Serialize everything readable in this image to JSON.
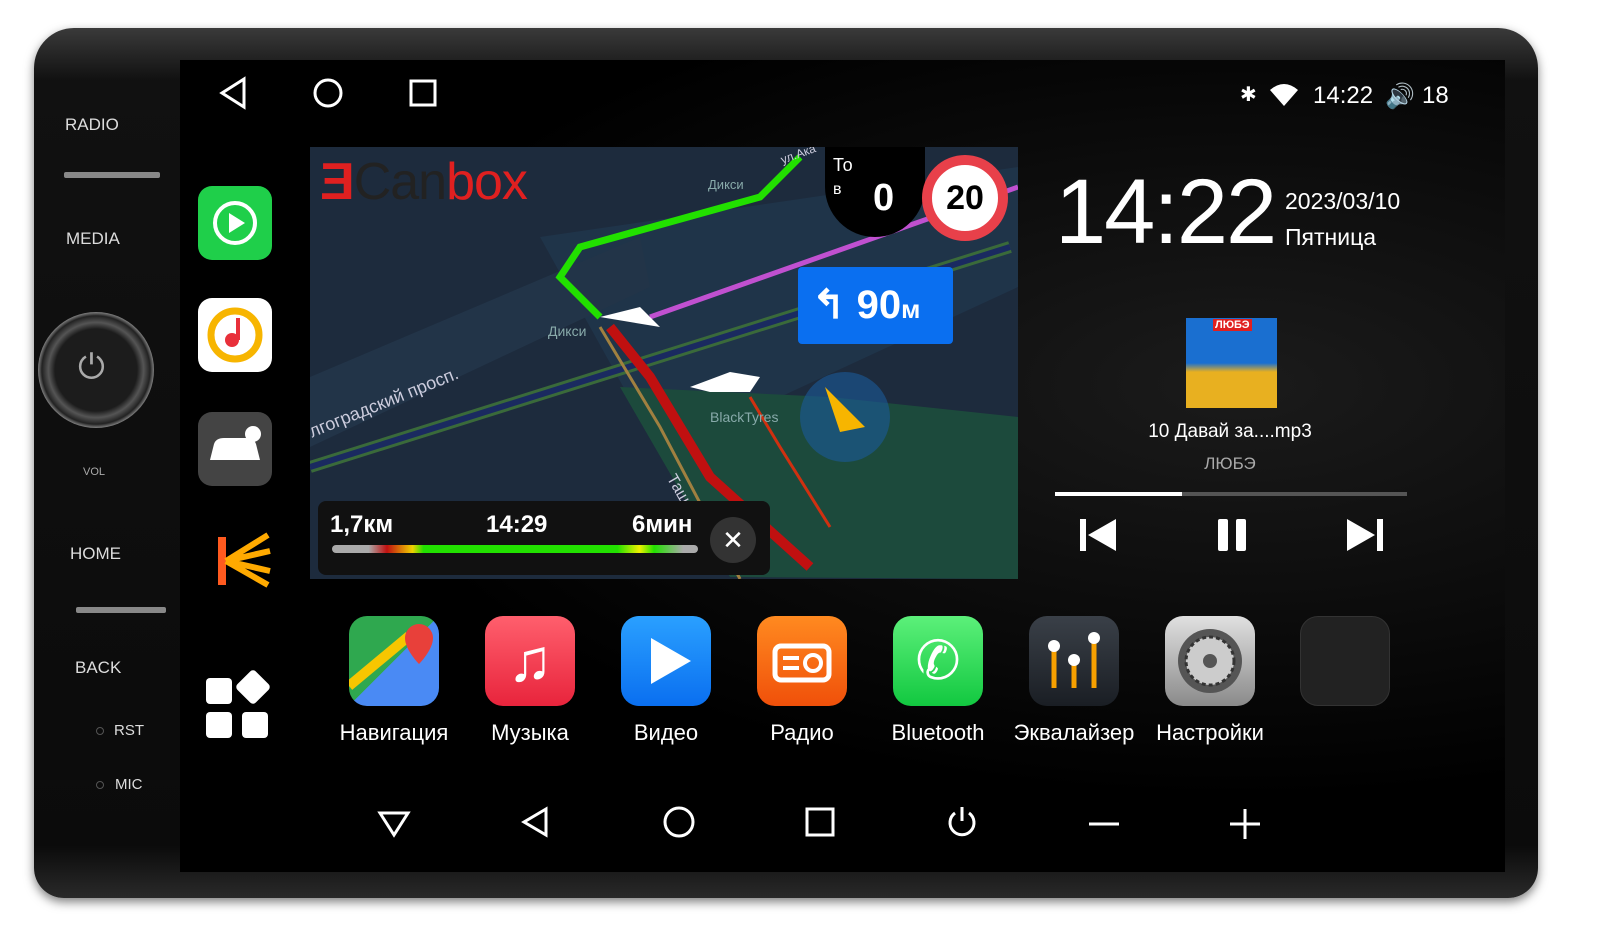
{
  "hardware": {
    "radio": "RADIO",
    "media": "MEDIA",
    "home": "HOME",
    "back": "BACK",
    "rst": "RST",
    "mic": "MIC",
    "vol": "VOL"
  },
  "status": {
    "time": "14:22",
    "volume": "18"
  },
  "clock": {
    "time": "14:22",
    "date": "2023/03/10",
    "weekday": "Пятница"
  },
  "music": {
    "album_badge": "ЛЮБЭ",
    "track": "10 Давай за....mp3",
    "artist": "ЛЮБЭ",
    "progress": 0.36
  },
  "map": {
    "logo_can": "Can",
    "logo_box": "box",
    "speed_label_1": "То",
    "speed_label_2": "в",
    "current_speed": "0",
    "speed_limit": "20",
    "maneuver_distance": "90",
    "maneuver_unit": "м",
    "poi_1": "Дикси",
    "poi_2": "Дикси",
    "poi_3": "BlackTyres",
    "street_1": "лгоградский просп.",
    "street_2": "Ташкентска",
    "street_3": "ул.Ака",
    "remaining_distance": "1,7км",
    "arrival_time": "14:29",
    "remaining_time": "6мин"
  },
  "dock": [
    {
      "label": "Навигация",
      "icon": "maps-icon"
    },
    {
      "label": "Музыка",
      "icon": "music-icon"
    },
    {
      "label": "Видео",
      "icon": "video-icon"
    },
    {
      "label": "Радио",
      "icon": "radio-icon"
    },
    {
      "label": "Bluetooth",
      "icon": "phone-icon"
    },
    {
      "label": "Эквалайзер",
      "icon": "equalizer-icon"
    },
    {
      "label": "Настройки",
      "icon": "settings-icon"
    }
  ],
  "colors": {
    "route_green": "#22e000",
    "maneuver_blue": "#0a6ff0",
    "speed_limit_red": "#e8404a",
    "logo_red": "#e02020"
  }
}
